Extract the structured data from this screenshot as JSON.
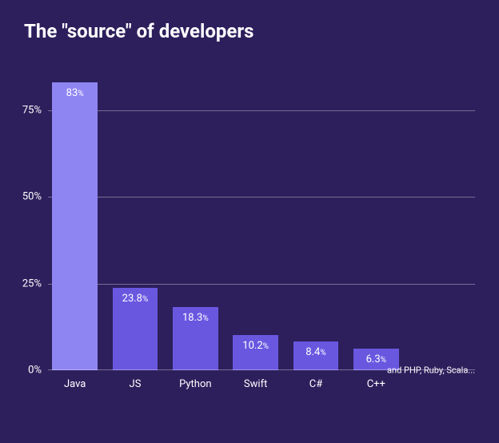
{
  "chart_data": {
    "type": "bar",
    "title": "The \"source\" of developers",
    "categories": [
      "Java",
      "JS",
      "Python",
      "Swift",
      "C#",
      "C++"
    ],
    "values": [
      83,
      23.8,
      18.3,
      10.2,
      8.4,
      6.3
    ],
    "value_labels": [
      "83",
      "23.8",
      "18.3",
      "10.2",
      "8.4",
      "6.3"
    ],
    "bar_colors": [
      "#8f85f2",
      "#6a57e0",
      "#6a57e0",
      "#6a57e0",
      "#6a57e0",
      "#6a57e0"
    ],
    "ylabel": "",
    "xlabel": "",
    "ylim": [
      0,
      90
    ],
    "y_ticks": [
      0,
      25,
      50,
      75
    ],
    "y_tick_labels": [
      "0%",
      "25%",
      "50%",
      "75%"
    ],
    "footnote": "and PHP, Ruby, Scala...",
    "value_unit": "%"
  }
}
